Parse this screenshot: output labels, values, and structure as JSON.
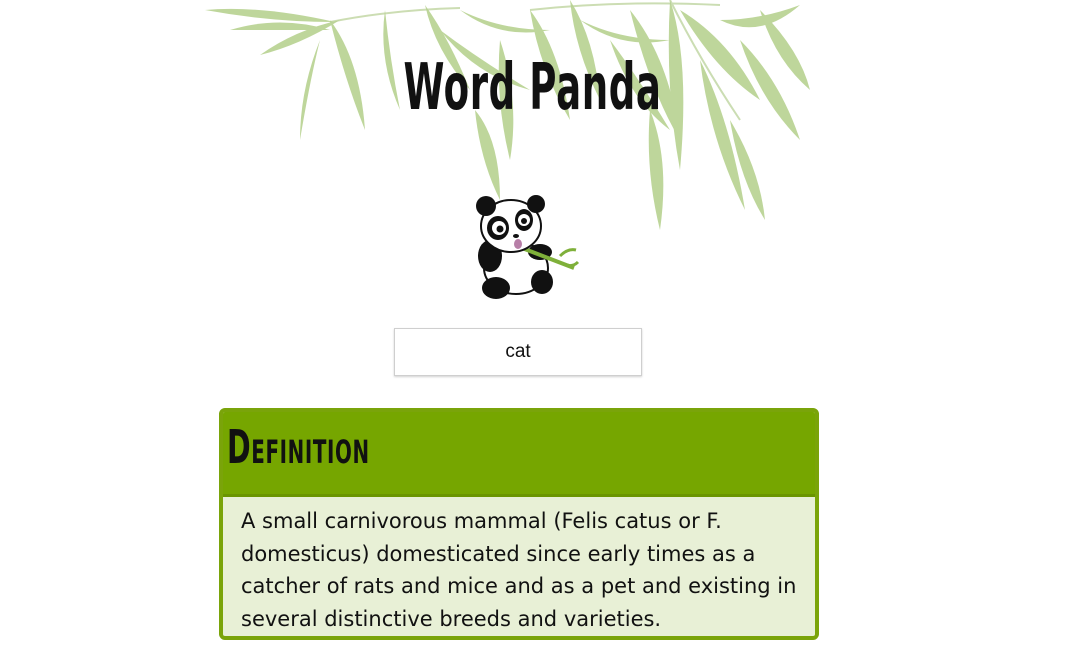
{
  "app": {
    "title": "Word Panda"
  },
  "search": {
    "value": "cat"
  },
  "definition": {
    "heading": "Definition",
    "text": "A small carnivorous mammal (Felis catus or F. domesticus) domesticated since early times as a catcher of rats and mice and as a pet and existing in several distinctive breeds and varieties."
  },
  "colors": {
    "accent": "#76a600",
    "card_border": "#7aa40a",
    "card_background": "#e8f0d6",
    "bamboo_leaf": "#9cc26b"
  },
  "icons": {
    "decoration": "bamboo-leaves",
    "mascot": "panda-eating-bamboo"
  }
}
